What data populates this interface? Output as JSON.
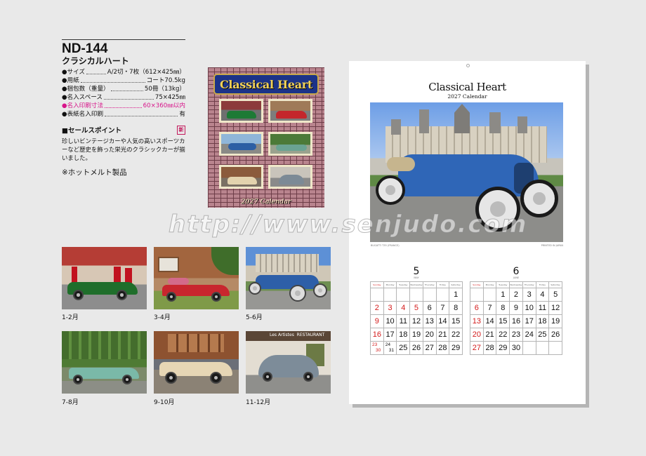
{
  "product": {
    "code": "ND-144",
    "name": "クラシカルハート",
    "specs": [
      {
        "label": "●サイズ",
        "value": "A/2切・7枚（612×425㎜）",
        "highlight": false
      },
      {
        "label": "●用紙",
        "value": "コート70.5kg",
        "highlight": false
      },
      {
        "label": "●梱包数（重量）",
        "value": "50冊（13kg）",
        "highlight": false
      },
      {
        "label": "●名入スペース",
        "value": "75×425㎜",
        "highlight": false
      },
      {
        "label": "●名入印刷寸法",
        "value": "60×360㎜以内",
        "highlight": true
      },
      {
        "label": "●表紙名入印刷",
        "value": "有",
        "highlight": false
      }
    ],
    "sales_heading": "■セールスポイント",
    "new_mark": "新",
    "sales_text": "珍しいビンテージカーや人気の高いスポーツカーなど歴史を飾った栄光のクラシックカーが揃いました。",
    "note": "※ホットメルト製品"
  },
  "cover": {
    "title": "Classical Heart",
    "year_label": "2027 Calendar"
  },
  "thumbnails": [
    {
      "label": "1-2月"
    },
    {
      "label": "3-4月"
    },
    {
      "label": "5-6月"
    },
    {
      "label": "7-8月"
    },
    {
      "label": "9-10月"
    },
    {
      "label": "11-12月"
    }
  ],
  "sheet": {
    "title": "Classical Heart",
    "subtitle": "2027 Calendar",
    "credit_left": "BUGATTI T35 (FRANCE)",
    "credit_right": "PRINTED IN JAPAN"
  },
  "calendar": {
    "weekdays": [
      "Sunday",
      "Monday",
      "Tuesday",
      "Wednesday",
      "Thursday",
      "Friday",
      "Saturday"
    ],
    "months": [
      {
        "number": "5",
        "name": "MAY",
        "cells": [
          {
            "t": ""
          },
          {
            "t": ""
          },
          {
            "t": ""
          },
          {
            "t": ""
          },
          {
            "t": ""
          },
          {
            "t": ""
          },
          {
            "t": "1"
          },
          {
            "t": "2",
            "red": true
          },
          {
            "t": "3",
            "red": true
          },
          {
            "t": "4",
            "red": true
          },
          {
            "t": "5",
            "red": true
          },
          {
            "t": "6"
          },
          {
            "t": "7"
          },
          {
            "t": "8"
          },
          {
            "t": "9",
            "red": true
          },
          {
            "t": "10"
          },
          {
            "t": "11"
          },
          {
            "t": "12"
          },
          {
            "t": "13"
          },
          {
            "t": "14"
          },
          {
            "t": "15"
          },
          {
            "t": "16",
            "red": true
          },
          {
            "t": "17"
          },
          {
            "t": "18"
          },
          {
            "t": "19"
          },
          {
            "t": "20"
          },
          {
            "t": "21"
          },
          {
            "t": "22"
          },
          {
            "t": "23",
            "b": "30",
            "red": true
          },
          {
            "t": "24",
            "b": "31"
          },
          {
            "t": "25"
          },
          {
            "t": "26"
          },
          {
            "t": "27"
          },
          {
            "t": "28"
          },
          {
            "t": "29"
          }
        ]
      },
      {
        "number": "6",
        "name": "JUNE",
        "cells": [
          {
            "t": ""
          },
          {
            "t": ""
          },
          {
            "t": "1"
          },
          {
            "t": "2"
          },
          {
            "t": "3"
          },
          {
            "t": "4"
          },
          {
            "t": "5"
          },
          {
            "t": "6",
            "red": true
          },
          {
            "t": "7"
          },
          {
            "t": "8"
          },
          {
            "t": "9"
          },
          {
            "t": "10"
          },
          {
            "t": "11"
          },
          {
            "t": "12"
          },
          {
            "t": "13",
            "red": true
          },
          {
            "t": "14"
          },
          {
            "t": "15"
          },
          {
            "t": "16"
          },
          {
            "t": "17"
          },
          {
            "t": "18"
          },
          {
            "t": "19"
          },
          {
            "t": "20",
            "red": true
          },
          {
            "t": "21"
          },
          {
            "t": "22"
          },
          {
            "t": "23"
          },
          {
            "t": "24"
          },
          {
            "t": "25"
          },
          {
            "t": "26"
          },
          {
            "t": "27",
            "red": true
          },
          {
            "t": "28"
          },
          {
            "t": "29"
          },
          {
            "t": "30"
          },
          {
            "t": ""
          },
          {
            "t": ""
          },
          {
            "t": ""
          }
        ]
      }
    ]
  },
  "watermark": "http://www.senjudo.com"
}
